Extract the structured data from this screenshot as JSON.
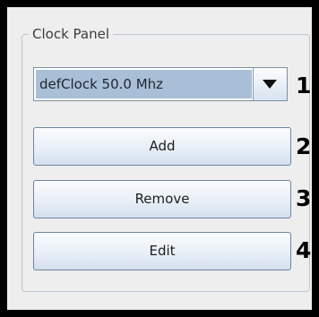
{
  "panel": {
    "title": "Clock Panel"
  },
  "clock_select": {
    "selected_value": "defClock 50.0 Mhz",
    "arrow_icon": "chevron-down-icon"
  },
  "buttons": {
    "add_label": "Add",
    "remove_label": "Remove",
    "edit_label": "Edit"
  },
  "annotations": [
    "1",
    "2",
    "3",
    "4"
  ],
  "colors": {
    "frame_border": "#000000",
    "panel_background": "#eeeeee",
    "selection_highlight": "#a9bfd7",
    "button_border": "#6f84a1"
  }
}
